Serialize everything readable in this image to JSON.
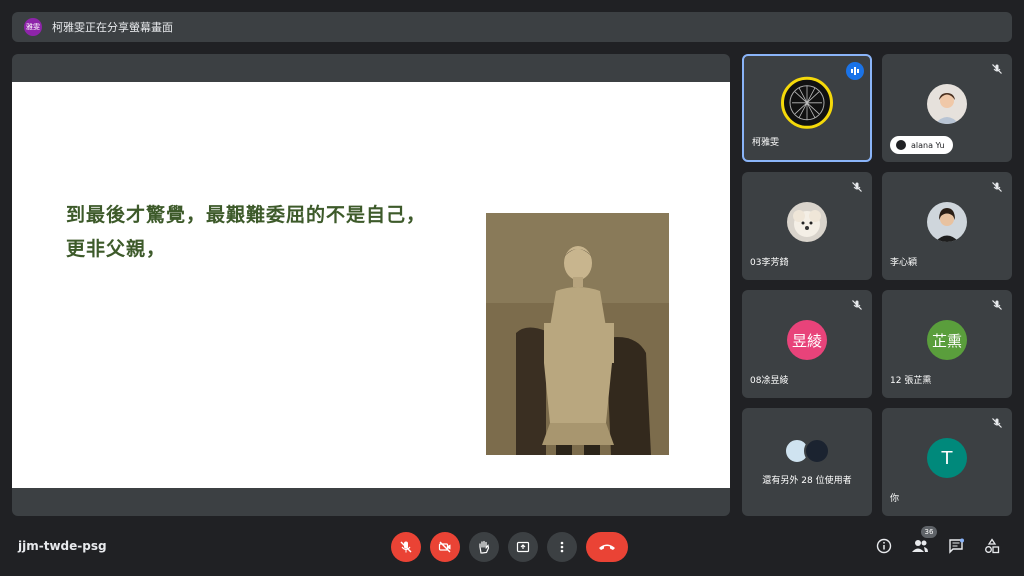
{
  "banner": {
    "avatar_text": "雅雯",
    "text": "柯雅雯正在分享螢幕畫面"
  },
  "slide": {
    "line1": "到最後才驚覺，最艱難委屈的不是自己，",
    "line2": "更非父親，"
  },
  "participants": [
    {
      "name": "柯雅雯",
      "speaking": true
    },
    {
      "name": "alana Yu",
      "muted": true
    },
    {
      "name": "03李芳錡",
      "muted": true
    },
    {
      "name": "李心穎",
      "muted": true
    },
    {
      "name": "08凃昱綾",
      "avatar_text": "昱綾",
      "avatar_color": "#e8437a",
      "muted": true
    },
    {
      "name": "12 張芷熏",
      "avatar_text": "芷熏",
      "avatar_color": "#5a9e3c",
      "muted": true
    },
    {
      "name": "還有另外 28 位使用者"
    },
    {
      "name": "你",
      "avatar_text": "T",
      "avatar_color": "#00897b",
      "muted": true
    }
  ],
  "footer": {
    "meeting_code": "jjm-twde-psg",
    "people_count": "36"
  },
  "colors": {
    "accent": "#8ab4f8",
    "danger": "#ea4335",
    "tile_bg": "#3c4043"
  },
  "icons": [
    "mic-off-icon",
    "camera-off-icon",
    "raise-hand-icon",
    "present-icon",
    "more-icon",
    "end-call-icon",
    "info-icon",
    "people-icon",
    "chat-icon",
    "activities-icon"
  ]
}
